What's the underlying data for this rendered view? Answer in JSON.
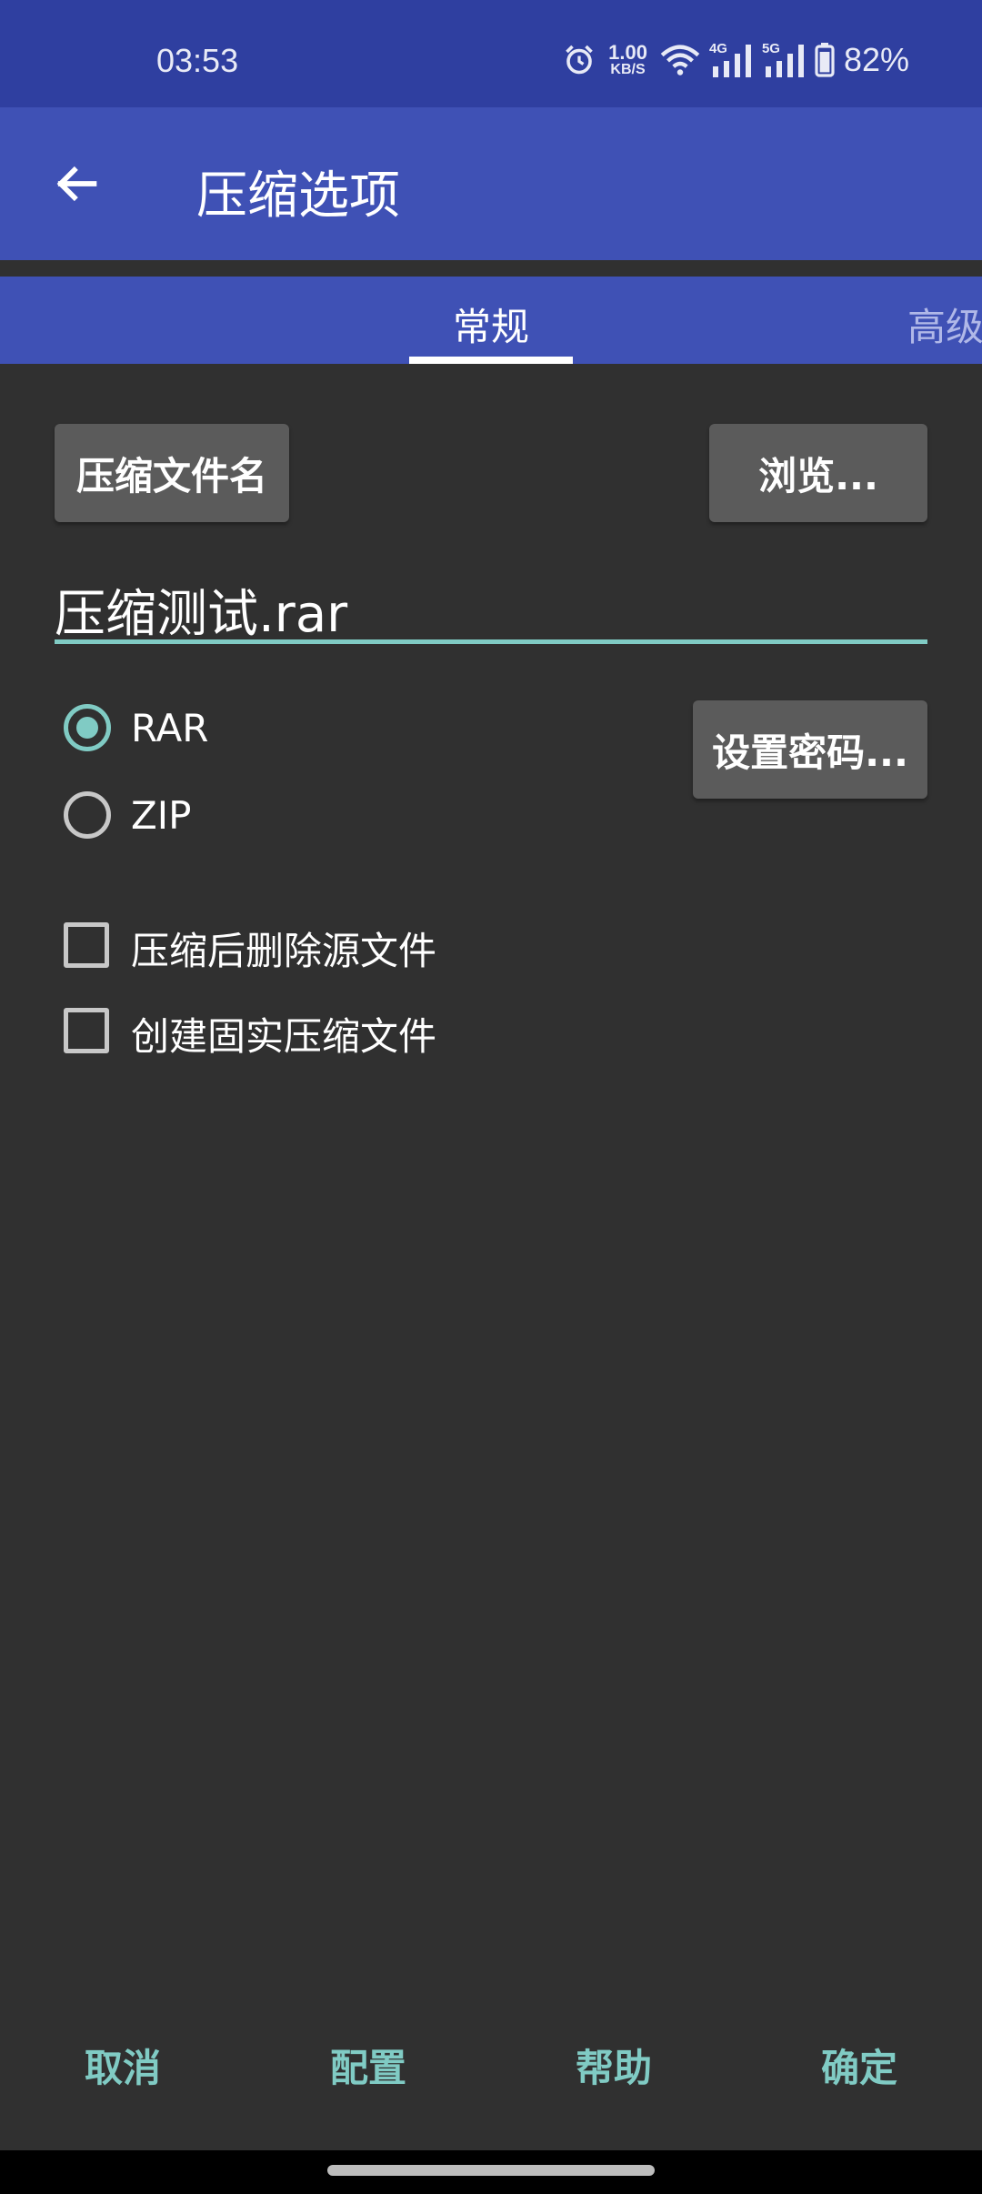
{
  "status_bar": {
    "time": "03:53",
    "net_speed_value": "1.00",
    "net_speed_unit": "KB/S",
    "sim1_label": "4G",
    "sim2_label": "5G",
    "battery_percent": "82%",
    "icons": [
      "alarm-icon",
      "wifi-icon",
      "signal-icon",
      "battery-icon"
    ]
  },
  "app_bar": {
    "title": "压缩选项",
    "back_icon": "arrow-left-icon"
  },
  "tabs": [
    {
      "label": "常规",
      "selected": true
    },
    {
      "label": "高级",
      "selected": false
    }
  ],
  "general": {
    "archive_name_button": "压缩文件名",
    "browse_button": "浏览...",
    "archive_filename": "压缩测试.rar",
    "formats": [
      {
        "label": "RAR",
        "selected": true
      },
      {
        "label": "ZIP",
        "selected": false
      }
    ],
    "set_password_button": "设置密码...",
    "options": [
      {
        "label": "压缩后删除源文件",
        "checked": false
      },
      {
        "label": "创建固实压缩文件",
        "checked": false
      }
    ]
  },
  "actions": {
    "cancel": "取消",
    "config": "配置",
    "help": "帮助",
    "ok": "确定"
  },
  "colors": {
    "status_bar": "#2f3fa0",
    "app_bar": "#3f51b5",
    "background": "#303030",
    "accent": "#80cbc4",
    "button": "#5b5b5b"
  }
}
